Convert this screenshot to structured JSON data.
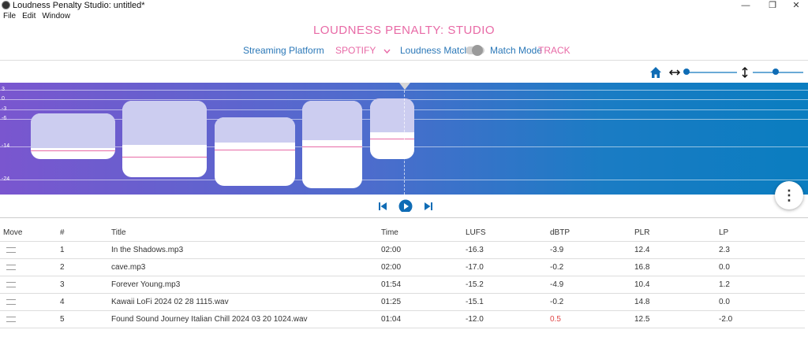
{
  "window": {
    "title": "Loudness Penalty Studio: untitled*",
    "minimize_glyph": "—",
    "maximize_glyph": "❐",
    "close_glyph": "✕"
  },
  "menu": [
    "File",
    "Edit",
    "Window"
  ],
  "app_title": "LOUDNESS PENALTY: STUDIO",
  "controls": {
    "streaming_platform_label": "Streaming Platform",
    "platform_value": "SPOTIFY",
    "loudness_match_label": "Loudness Match",
    "loudness_match_on": false,
    "match_mode_label": "Match Mode",
    "match_mode_value": "TRACK"
  },
  "toolbar": {
    "home_icon": "home-icon",
    "h_zoom_icon": "horizontal-zoom-icon",
    "v_zoom_icon": "vertical-zoom-icon",
    "h_zoom_level": 0.0,
    "v_zoom_level": 0.45
  },
  "waveform": {
    "ticks": [
      "3",
      "0",
      "-3",
      "-6",
      "-14",
      "-24"
    ],
    "playhead_fraction": 0.5,
    "colors": {
      "gradient_start": "#7a56cf",
      "gradient_end": "#0a7dc0",
      "lufs_line": "#e86aa6",
      "clip_upper": "#cccdf0"
    }
  },
  "transport": {
    "prev_icon": "skip-previous-icon",
    "play_icon": "play-icon",
    "next_icon": "skip-next-icon"
  },
  "table": {
    "headers": [
      "Move",
      "#",
      "Title",
      "Time",
      "LUFS",
      "dBTP",
      "PLR",
      "LP"
    ],
    "rows": [
      {
        "num": "1",
        "title": "In the Shadows.mp3",
        "time": "02:00",
        "lufs": "-16.3",
        "dbtp": "-3.9",
        "plr": "12.4",
        "lp": "2.3"
      },
      {
        "num": "2",
        "title": "cave.mp3",
        "time": "02:00",
        "lufs": "-17.0",
        "dbtp": "-0.2",
        "plr": "16.8",
        "lp": "0.0"
      },
      {
        "num": "3",
        "title": "Forever Young.mp3",
        "time": "01:54",
        "lufs": "-15.2",
        "dbtp": "-4.9",
        "plr": "10.4",
        "lp": "1.2"
      },
      {
        "num": "4",
        "title": "Kawaii LoFi 2024 02 28 1115.wav",
        "time": "01:25",
        "lufs": "-15.1",
        "dbtp": "-0.2",
        "plr": "14.8",
        "lp": "0.0"
      },
      {
        "num": "5",
        "title": "Found Sound Journey Italian Chill 2024 03 20 1024.wav",
        "time": "01:04",
        "lufs": "-12.0",
        "dbtp": "0.5",
        "plr": "12.5",
        "lp": "-2.0"
      }
    ],
    "warning_color": "#e04848"
  },
  "more_button_glyph": "⋮"
}
